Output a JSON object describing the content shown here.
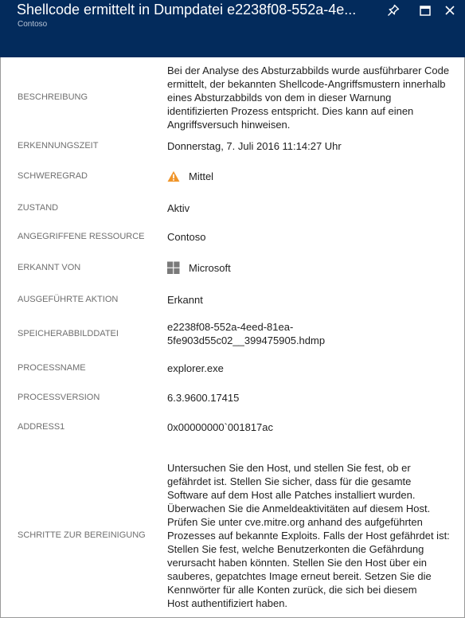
{
  "window": {
    "title": "Shellcode ermittelt in Dumpdatei e2238f08-552a-4e...",
    "subtitle": "Contoso",
    "controls": {
      "pin": "pin-icon",
      "maximize": "maximize-icon",
      "close": "close-icon"
    }
  },
  "colors": {
    "header": "#032b5c",
    "header_text": "#ffffff",
    "subtitle": "#b8c4d6",
    "label": "#6f6f6f",
    "value": "#1f1f1f",
    "warning": "#f0952a",
    "windows_logo": "#7a7a7a",
    "border": "#9a9a9a"
  },
  "details": [
    {
      "label": "BESCHREIBUNG",
      "value": "Bei der Analyse des Absturzabbilds wurde ausführbarer Code\nermittelt, der bekannten Shellcode-Angriffsmustern innerhalb\neines Absturzabbilds von dem in dieser Warnung\nidentifizierten Prozess entspricht. Dies kann auf einen\nAngriffsversuch hinweisen."
    },
    {
      "label": "ERKENNUNGSZEIT",
      "value": "Donnerstag, 7. Juli 2016 11:14:27 Uhr"
    },
    {
      "label": "SCHWEREGRAD",
      "value": "Mittel",
      "icon": "warning-icon"
    },
    {
      "label": "ZUSTAND",
      "value": "Aktiv"
    },
    {
      "label": "ANGEGRIFFENE RESSOURCE",
      "value": "Contoso"
    },
    {
      "label": "ERKANNT VON",
      "value": "Microsoft",
      "icon": "windows-logo-icon"
    },
    {
      "label": "AUSGEFÜHRTE AKTION",
      "value": "Erkannt"
    },
    {
      "label": "SPEICHERABBILDDATEI",
      "value": "e2238f08-552a-4eed-81ea-\n5fe903d55c02__399475905.hdmp"
    },
    {
      "label": "PROCESSNAME",
      "value": "explorer.exe"
    },
    {
      "label": "PROCESSVERSION",
      "value": "6.3.9600.17415"
    },
    {
      "label": "ADDRESS1",
      "value": "0x00000000`001817ac"
    },
    {
      "label": "SCHRITTE ZUR BEREINIGUNG",
      "value": "Untersuchen Sie den Host, und stellen Sie fest, ob er\ngefährdet ist. Stellen Sie sicher, dass für die gesamte\nSoftware auf dem Host alle Patches installiert wurden.\nÜberwachen Sie die Anmeldeaktivitäten auf diesem Host.\nPrüfen Sie unter cve.mitre.org anhand des aufgeführten\nProzesses auf bekannte Exploits. Falls der Host gefährdet ist:\nStellen Sie fest, welche Benutzerkonten die Gefährdung\nverursacht haben könnten. Stellen Sie den Host über ein\nsauberes, gepatchtes Image erneut bereit. Setzen Sie die\nKennwörter für alle Konten zurück, die sich bei diesem\nHost authentifiziert haben."
    }
  ]
}
